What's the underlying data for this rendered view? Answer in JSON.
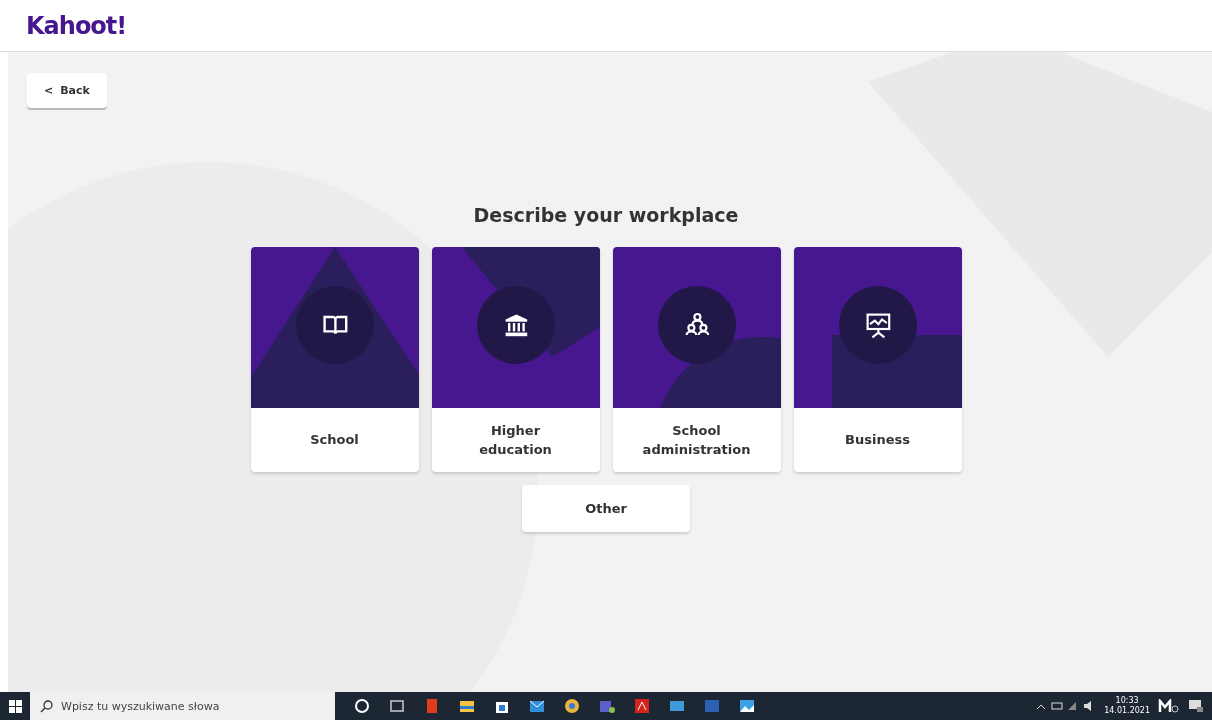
{
  "header": {
    "logo": "Kahoot!"
  },
  "back_button": {
    "label": "Back",
    "icon": "<"
  },
  "title": "Describe your workplace",
  "options": [
    {
      "label": "School"
    },
    {
      "label": "Higher education"
    },
    {
      "label": "School administration"
    },
    {
      "label": "Business"
    }
  ],
  "other_button": "Other",
  "taskbar": {
    "search_placeholder": "Wpisz tu wyszukiwane słowa",
    "time": "10:33",
    "date": "14.01.2021"
  }
}
